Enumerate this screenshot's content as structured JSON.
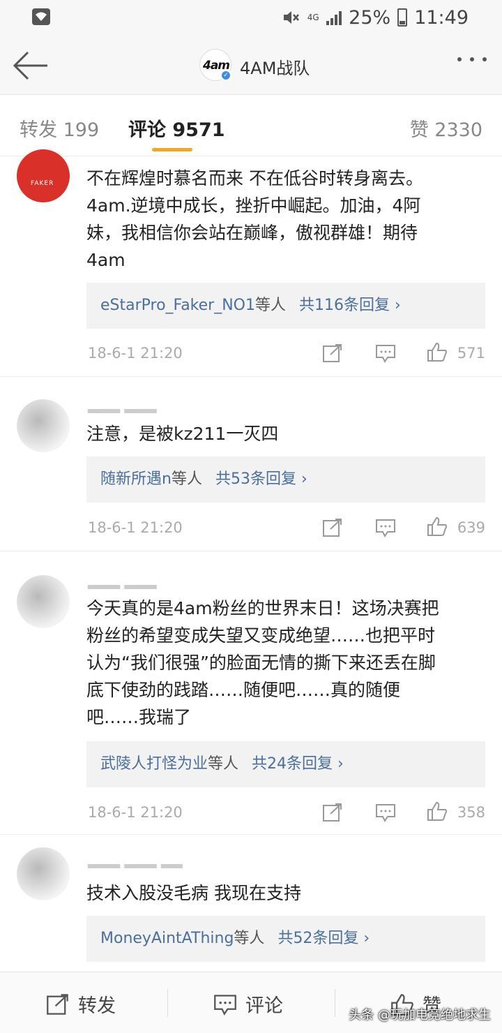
{
  "status_bar": {
    "network": "4G",
    "battery": "25%",
    "time": "11:49"
  },
  "header": {
    "title": "4AM战队",
    "avatar_logo": "4am"
  },
  "tabs": {
    "repost": "转发 199",
    "comment": "评论 9571",
    "likes": "赞 2330"
  },
  "comments": [
    {
      "avatar_text": "FAKER",
      "text": "不在辉煌时慕名而来 不在低谷时转身离去。4am.逆境中成长，挫折中崛起。加油，4阿妹，我相信你会站在巅峰，傲视群雄！期待4am",
      "reply_names": "eStarPro_Faker_NO1",
      "reply_mid": "等人",
      "reply_count": "共116条回复 ›",
      "time": "18-6-1 21:20",
      "likes": "571"
    },
    {
      "text": "注意，是被kz211一灭四",
      "reply_names": "随新所遇n",
      "reply_mid": "等人",
      "reply_count": "共53条回复 ›",
      "time": "18-6-1 21:20",
      "likes": "639"
    },
    {
      "text": "今天真的是4am粉丝的世界末日！这场决赛把粉丝的希望变成失望又变成绝望……也把平时认为“我们很强”的脸面无情的撕下来还丢在脚底下使劲的践踏……随便吧……真的随便吧……我瑞了",
      "reply_names": "武陵人打怪为业",
      "reply_mid": "等人",
      "reply_count": "共24条回复 ›",
      "time": "18-6-1 21:20",
      "likes": "358"
    },
    {
      "text": "技术入股没毛病 我现在支持",
      "reply_names": "MoneyAintAThing",
      "reply_mid": "等人",
      "reply_count": "共52条回复 ›"
    }
  ],
  "bottom_bar": {
    "repost": "转发",
    "comment": "评论",
    "like": "赞"
  },
  "watermark": "头条 @玩加电竞绝地求生",
  "colors": {
    "accent": "#f5a623",
    "link": "#4a6f9c"
  }
}
